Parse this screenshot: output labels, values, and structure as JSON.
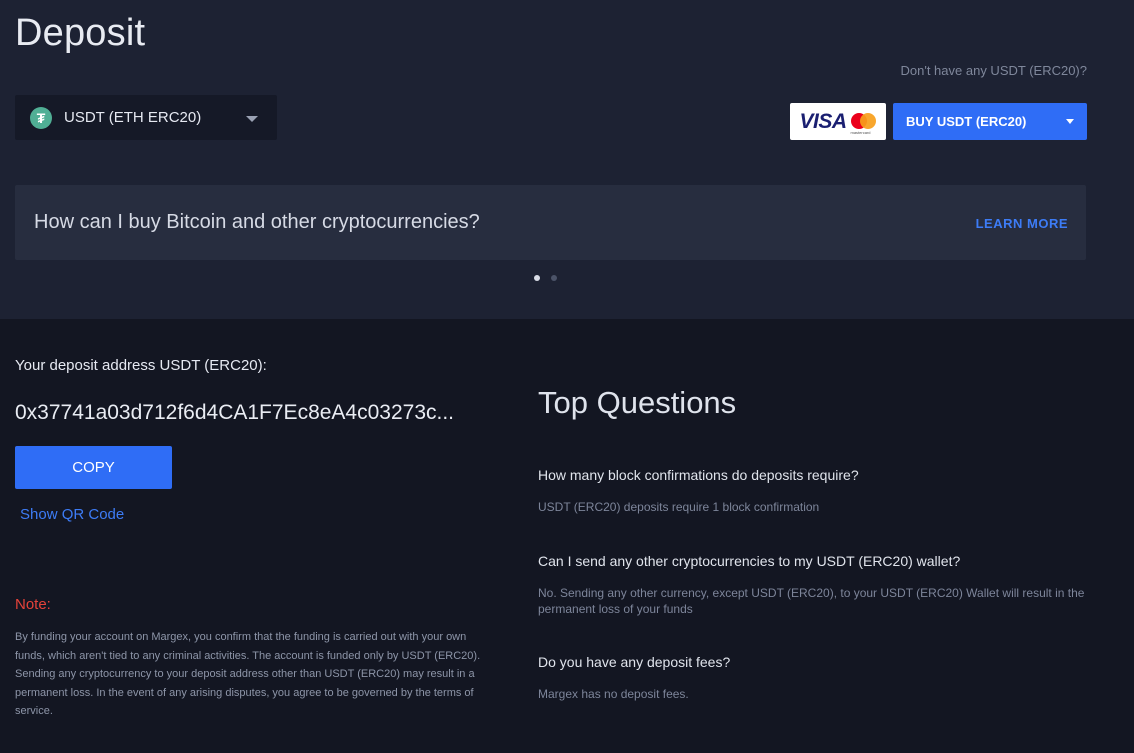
{
  "header": {
    "title": "Deposit",
    "no_usdt_text": "Don't have any USDT (ERC20)?"
  },
  "currency_select": {
    "icon": "tether-icon",
    "icon_glyph": "₮",
    "label": "USDT (ETH ERC20)"
  },
  "payment": {
    "visa_text": "VISA",
    "mastercard_text": "mastercard",
    "buy_label": "BUY USDT (ERC20)"
  },
  "banner": {
    "text": "How can I buy Bitcoin and other cryptocurrencies?",
    "learn_more": "LEARN MORE"
  },
  "deposit": {
    "address_label": "Your deposit address USDT (ERC20):",
    "address_value": "0x37741a03d712f6d4CA1F7Ec8eA4c03273c...",
    "copy_label": "COPY",
    "qr_label": "Show QR Code"
  },
  "note": {
    "title": "Note:",
    "text": "By funding your account on Margex, you confirm that the funding is carried out with your own funds, which aren't tied to any criminal activities. The account is funded only by USDT (ERC20). Sending any cryptocurrency to your deposit address other than USDT (ERC20) may result in a permanent loss. In the event of any arising disputes, you agree to be governed by the terms of service."
  },
  "faq": {
    "title": "Top Questions",
    "items": [
      {
        "question": "How many block confirmations do deposits require?",
        "answer": "USDT (ERC20) deposits require 1 block confirmation"
      },
      {
        "question": "Can I send any other cryptocurrencies to my USDT (ERC20) wallet?",
        "answer": "No. Sending any other currency, except USDT (ERC20), to your USDT (ERC20) Wallet will result in the permanent loss of your funds"
      },
      {
        "question": "Do you have any deposit fees?",
        "answer": "Margex has no deposit fees."
      }
    ]
  },
  "colors": {
    "accent": "#2f6df6",
    "link": "#3d7cf6",
    "note": "#e5423a",
    "tether": "#50af95"
  }
}
